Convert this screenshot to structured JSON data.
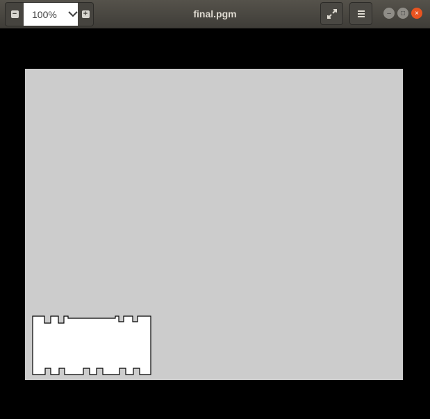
{
  "header": {
    "zoom_value": "100%",
    "zoom_out_icon": "minus-icon",
    "zoom_in_icon": "plus-icon",
    "title": "final.pgm",
    "fullscreen_icon": "fullscreen-icon",
    "menu_icon": "hamburger-icon"
  },
  "colors": {
    "canvas": "#cccccc",
    "shape_fill": "#ffffff",
    "close": "#e95420"
  }
}
